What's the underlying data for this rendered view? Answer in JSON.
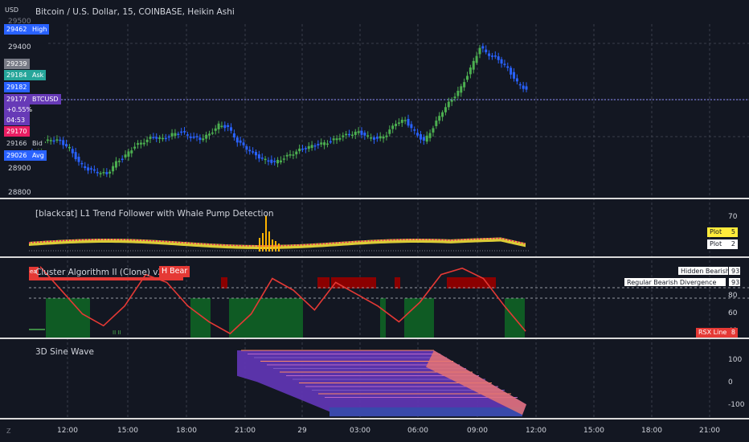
{
  "header": {
    "currency": "USD",
    "title": "Bitcoin / U.S. Dollar, 15, COINBASE, Heikin Ashi"
  },
  "price_axis": {
    "ticks": [
      "29400",
      "28900",
      "28800",
      "29500"
    ],
    "markers": [
      {
        "value": "29462",
        "label": "High",
        "color": "#2962ff"
      },
      {
        "value": "29239",
        "label": "",
        "color": "#787b86"
      },
      {
        "value": "29184",
        "label": "Ask",
        "color": "#26a69a"
      },
      {
        "value": "29182",
        "label": "",
        "color": "#2962ff"
      },
      {
        "value": "29177",
        "label": "BTCUSD",
        "color": "#673ab7"
      },
      {
        "value": "+0.55%",
        "label": "",
        "color": "#673ab7"
      },
      {
        "value": "04:53",
        "label": "",
        "color": "#673ab7"
      },
      {
        "value": "29170",
        "label": "",
        "color": "#e91e63"
      },
      {
        "value": "29166",
        "label": "Bid",
        "color": "#131722"
      },
      {
        "value": "29026",
        "label": "Avg",
        "color": "#2962ff"
      }
    ]
  },
  "panes": {
    "l1": {
      "title": "[blackcat] L1 Trend Follower with Whale Pump Detection",
      "tick": "70",
      "legend": [
        {
          "label": "Plot",
          "value": "5",
          "bg": "#ffeb3b",
          "fg": "#131722"
        },
        {
          "label": "Plot",
          "value": "2",
          "bg": "#ffffff",
          "fg": "#131722"
        }
      ]
    },
    "cluster": {
      "title": "Cluster Algorithm II (Clone) v2",
      "left_tag": "ea",
      "h_bear": "H Bear",
      "ticks": [
        "80",
        "60",
        "40"
      ],
      "legend": [
        {
          "label": "Hidden Bearish",
          "value": "93"
        },
        {
          "label": "Regular Bearish Divergence",
          "value": "93"
        }
      ],
      "rsx": {
        "label": "RSX Line",
        "value": "8"
      },
      "bottom_marks": "II II"
    },
    "sine": {
      "title": "3D Sine Wave",
      "ticks": [
        "100",
        "0",
        "-100"
      ]
    }
  },
  "time_axis": {
    "z_label": "Z",
    "labels": [
      "12:00",
      "15:00",
      "18:00",
      "21:00",
      "29",
      "03:00",
      "06:00",
      "09:00",
      "12:00",
      "15:00",
      "18:00",
      "21:00"
    ]
  },
  "colors": {
    "background": "#131722",
    "bull": "#4caf50",
    "bear": "#2962ff",
    "bear_zone": "#8b0000",
    "bull_zone": "#0f5b24",
    "sine_fill": "#5e35b1"
  },
  "chart_data": [
    {
      "type": "candlestick",
      "title": "Bitcoin / U.S. Dollar, 15, COINBASE, Heikin Ashi",
      "ylim": [
        28780,
        29520
      ],
      "x": [
        "12:00",
        "15:00",
        "18:00",
        "21:00",
        "29",
        "03:00",
        "06:00",
        "09:00",
        "12:00"
      ],
      "close_path": [
        29000,
        29010,
        29030,
        29020,
        28990,
        28930,
        28900,
        28890,
        28880,
        28930,
        28960,
        29000,
        29020,
        29040,
        29030,
        29050,
        29060,
        29040,
        29030,
        29050,
        29090,
        29080,
        29020,
        28990,
        28960,
        28940,
        28930,
        28950,
        28970,
        28990,
        29000,
        29010,
        29020,
        29040,
        29050,
        29060,
        29040,
        29030,
        29050,
        29100,
        29110,
        29060,
        29020,
        29080,
        29150,
        29200,
        29250,
        29330,
        29420,
        29390,
        29370,
        29330,
        29270,
        29240
      ]
    },
    {
      "type": "line",
      "title": "[blackcat] L1 Trend Follower with Whale Pump Detection",
      "series": [
        {
          "name": "Plot",
          "values": [
            5
          ]
        },
        {
          "name": "Plot",
          "values": [
            2
          ]
        }
      ]
    },
    {
      "type": "line",
      "title": "Cluster Algorithm II (Clone) v2",
      "ylim": [
        0,
        100
      ],
      "series": [
        {
          "name": "RSX Line",
          "values": [
            90,
            60,
            30,
            15,
            40,
            80,
            70,
            40,
            20,
            5,
            30,
            75,
            60,
            35,
            70,
            55,
            40,
            20,
            45,
            80,
            88,
            75,
            40,
            8
          ]
        }
      ],
      "annotations": [
        "Hidden Bearish 93",
        "Regular Bearish Divergence 93"
      ]
    },
    {
      "type": "area",
      "title": "3D Sine Wave",
      "ylim": [
        -130,
        130
      ]
    }
  ]
}
